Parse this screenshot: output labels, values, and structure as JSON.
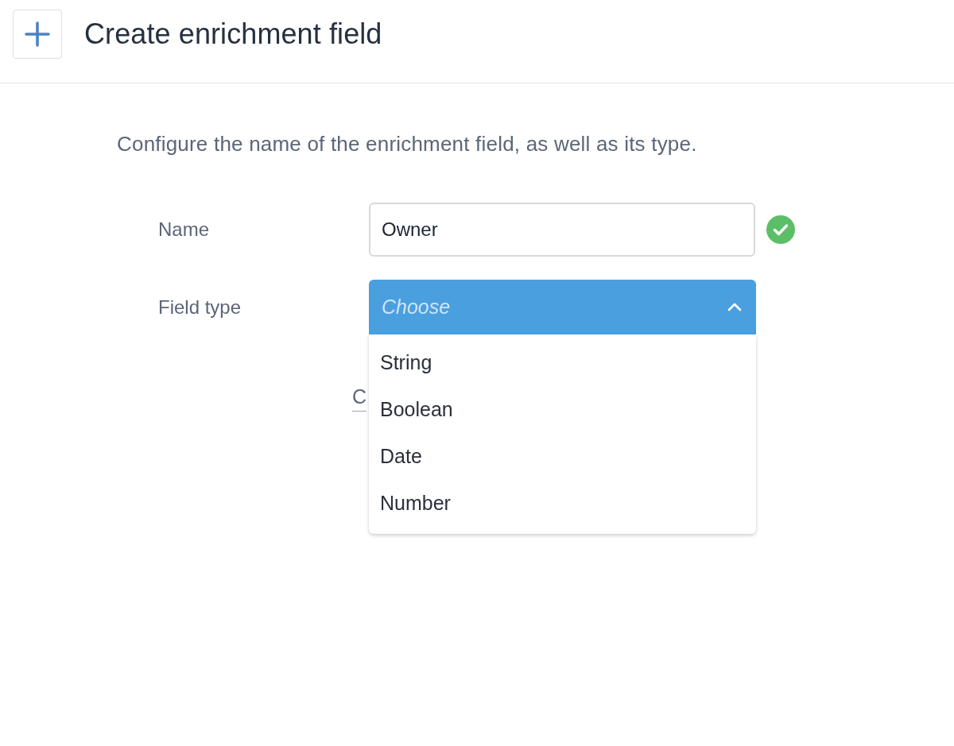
{
  "header": {
    "title": "Create enrichment field"
  },
  "description": "Configure the name of the enrichment field, as well as its type.",
  "form": {
    "fields": [
      {
        "kind": "text",
        "label": "Name",
        "value": "Owner",
        "valid": true
      },
      {
        "kind": "select",
        "label": "Field type",
        "placeholder": "Choose",
        "expanded": true,
        "options": [
          {
            "label": "String",
            "selected": false
          },
          {
            "label": "Boolean",
            "selected": false
          },
          {
            "label": "Date",
            "selected": false
          },
          {
            "label": "Number",
            "selected": false
          }
        ]
      }
    ]
  },
  "footer": {
    "link": "C"
  }
}
